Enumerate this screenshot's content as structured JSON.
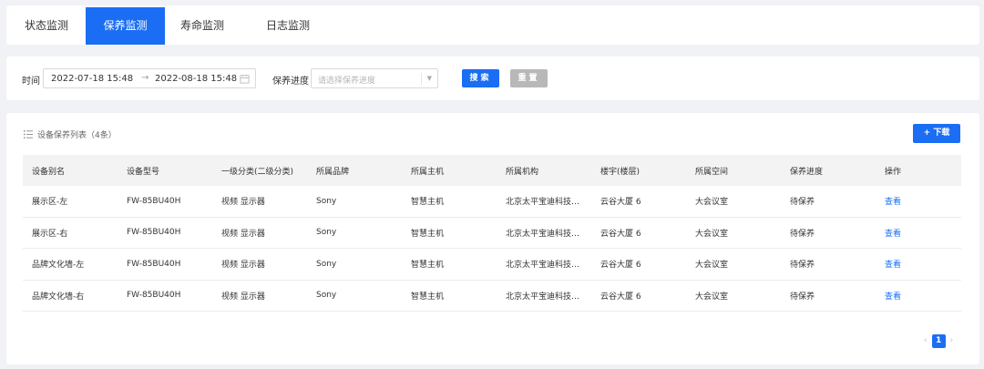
{
  "tabs": [
    {
      "label": "状态监测",
      "active": false
    },
    {
      "label": "保养监测",
      "active": true
    },
    {
      "label": "寿命监测",
      "active": false
    },
    {
      "label": "日志监测",
      "active": false
    }
  ],
  "filter": {
    "time_label": "时间",
    "date_start": "2022-07-18 15:48",
    "date_sep": "→",
    "date_end": "2022-08-18 15:48",
    "progress_label": "保养进度",
    "progress_placeholder": "请选择保养进度",
    "search_label": "搜索",
    "reset_label": "重置"
  },
  "list": {
    "title": "设备保养列表（4条）",
    "download_label": "+ 下载",
    "columns": [
      "设备别名",
      "设备型号",
      "一级分类(二级分类)",
      "所属品牌",
      "所属主机",
      "所属机构",
      "楼宇(楼层)",
      "所属空间",
      "保养进度",
      "操作"
    ],
    "rows": [
      [
        "展示区-左",
        "FW-85BU40H",
        "视频  显示器",
        "Sony",
        "智慧主机",
        "北京太平宝迪科技…",
        "云谷大厦  6",
        "大会议室",
        "待保养",
        "查看"
      ],
      [
        "展示区-右",
        "FW-85BU40H",
        "视频  显示器",
        "Sony",
        "智慧主机",
        "北京太平宝迪科技…",
        "云谷大厦  6",
        "大会议室",
        "待保养",
        "查看"
      ],
      [
        "品牌文化墙-左",
        "FW-85BU40H",
        "视频  显示器",
        "Sony",
        "智慧主机",
        "北京太平宝迪科技…",
        "云谷大厦  6",
        "大会议室",
        "待保养",
        "查看"
      ],
      [
        "品牌文化墙-右",
        "FW-85BU40H",
        "视频  显示器",
        "Sony",
        "智慧主机",
        "北京太平宝迪科技…",
        "云谷大厦  6",
        "大会议室",
        "待保养",
        "查看"
      ]
    ]
  },
  "pagination": {
    "prev": "‹",
    "current": "1",
    "next": "›"
  },
  "colors": {
    "accent": "#1b6ef3",
    "reset": "#b8b8b8",
    "background": "#f0f2f5"
  }
}
